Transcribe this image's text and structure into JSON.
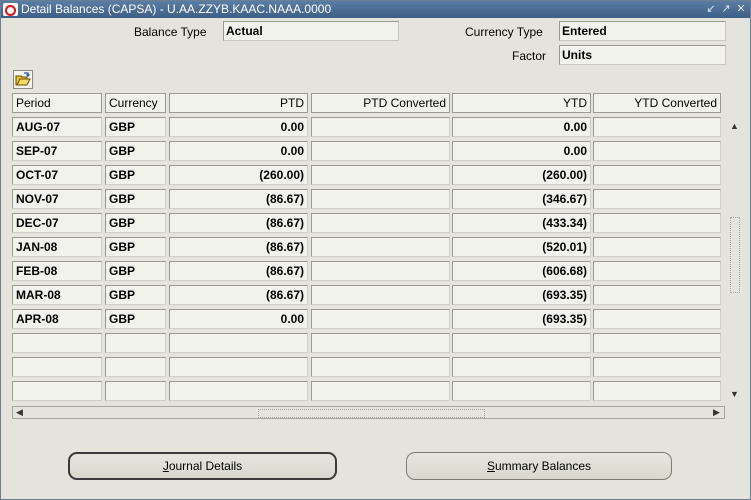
{
  "window": {
    "title": "Detail Balances (CAPSA) - U.AA.ZZYB.KAAC.NAAA.0000",
    "controls": [
      "minimize-icon",
      "restore-icon",
      "close-icon"
    ]
  },
  "form": {
    "balance_type_label": "Balance Type",
    "balance_type_value": "Actual",
    "currency_type_label": "Currency Type",
    "currency_type_value": "Entered",
    "factor_label": "Factor",
    "factor_value": "Units"
  },
  "toolbar": {
    "open_folder_icon": "open-folder-icon"
  },
  "table": {
    "columns": [
      "Period",
      "Currency",
      "PTD",
      "PTD Converted",
      "YTD",
      "YTD Converted"
    ],
    "rows": [
      {
        "period": "AUG-07",
        "currency": "GBP",
        "ptd": "0.00",
        "ptd_converted": "",
        "ytd": "0.00",
        "ytd_converted": ""
      },
      {
        "period": "SEP-07",
        "currency": "GBP",
        "ptd": "0.00",
        "ptd_converted": "",
        "ytd": "0.00",
        "ytd_converted": ""
      },
      {
        "period": "OCT-07",
        "currency": "GBP",
        "ptd": "(260.00)",
        "ptd_converted": "",
        "ytd": "(260.00)",
        "ytd_converted": ""
      },
      {
        "period": "NOV-07",
        "currency": "GBP",
        "ptd": "(86.67)",
        "ptd_converted": "",
        "ytd": "(346.67)",
        "ytd_converted": ""
      },
      {
        "period": "DEC-07",
        "currency": "GBP",
        "ptd": "(86.67)",
        "ptd_converted": "",
        "ytd": "(433.34)",
        "ytd_converted": ""
      },
      {
        "period": "JAN-08",
        "currency": "GBP",
        "ptd": "(86.67)",
        "ptd_converted": "",
        "ytd": "(520.01)",
        "ytd_converted": ""
      },
      {
        "period": "FEB-08",
        "currency": "GBP",
        "ptd": "(86.67)",
        "ptd_converted": "",
        "ytd": "(606.68)",
        "ytd_converted": ""
      },
      {
        "period": "MAR-08",
        "currency": "GBP",
        "ptd": "(86.67)",
        "ptd_converted": "",
        "ytd": "(693.35)",
        "ytd_converted": ""
      },
      {
        "period": "APR-08",
        "currency": "GBP",
        "ptd": "0.00",
        "ptd_converted": "",
        "ytd": "(693.35)",
        "ytd_converted": ""
      },
      {
        "period": "",
        "currency": "",
        "ptd": "",
        "ptd_converted": "",
        "ytd": "",
        "ytd_converted": ""
      },
      {
        "period": "",
        "currency": "",
        "ptd": "",
        "ptd_converted": "",
        "ytd": "",
        "ytd_converted": ""
      },
      {
        "period": "",
        "currency": "",
        "ptd": "",
        "ptd_converted": "",
        "ytd": "",
        "ytd_converted": ""
      }
    ]
  },
  "buttons": {
    "journal_details": {
      "mnemonic": "J",
      "rest": "ournal Details"
    },
    "summary_balances": {
      "mnemonic": "S",
      "rest": "ummary Balances"
    }
  },
  "colors": {
    "titlebar": "#4a6d95",
    "background": "#e4e4dc",
    "field": "#f2f2ec"
  }
}
